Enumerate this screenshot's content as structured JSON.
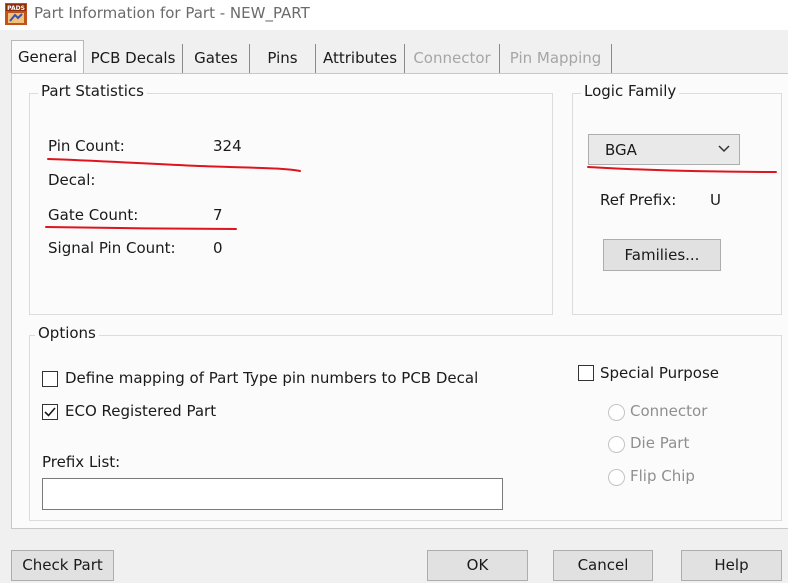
{
  "window": {
    "title": "Part Information for Part - NEW_PART",
    "icon": "pads-app-icon",
    "icon_text": "PADS"
  },
  "tabs": [
    {
      "label": "General",
      "selected": true,
      "enabled": true
    },
    {
      "label": "PCB Decals",
      "selected": false,
      "enabled": true
    },
    {
      "label": "Gates",
      "selected": false,
      "enabled": true
    },
    {
      "label": "Pins",
      "selected": false,
      "enabled": true
    },
    {
      "label": "Attributes",
      "selected": false,
      "enabled": true
    },
    {
      "label": "Connector",
      "selected": false,
      "enabled": false
    },
    {
      "label": "Pin Mapping",
      "selected": false,
      "enabled": false
    }
  ],
  "part_statistics": {
    "legend": "Part Statistics",
    "pin_count_label": "Pin Count:",
    "pin_count_value": "324",
    "decal_label": "Decal:",
    "decal_value": "",
    "gate_count_label": "Gate Count:",
    "gate_count_value": "7",
    "signal_pin_count_label": "Signal Pin Count:",
    "signal_pin_count_value": "0"
  },
  "logic_family": {
    "legend": "Logic Family",
    "selected": "BGA",
    "ref_prefix_label": "Ref Prefix:",
    "ref_prefix_value": "U",
    "families_button": "Families..."
  },
  "options": {
    "legend": "Options",
    "define_mapping_label": "Define mapping of Part Type pin numbers to PCB Decal",
    "define_mapping_checked": false,
    "eco_registered_label": "ECO Registered Part",
    "eco_registered_checked": true,
    "prefix_list_label": "Prefix List:",
    "prefix_list_value": "",
    "special_purpose_label": "Special Purpose",
    "special_purpose_checked": false,
    "special_options": [
      {
        "label": "Connector",
        "enabled": false
      },
      {
        "label": "Die Part",
        "enabled": false
      },
      {
        "label": "Flip Chip",
        "enabled": false
      }
    ]
  },
  "footer": {
    "check_part": "Check Part",
    "ok": "OK",
    "cancel": "Cancel",
    "help": "Help"
  },
  "annotation_color": "#e0141e"
}
